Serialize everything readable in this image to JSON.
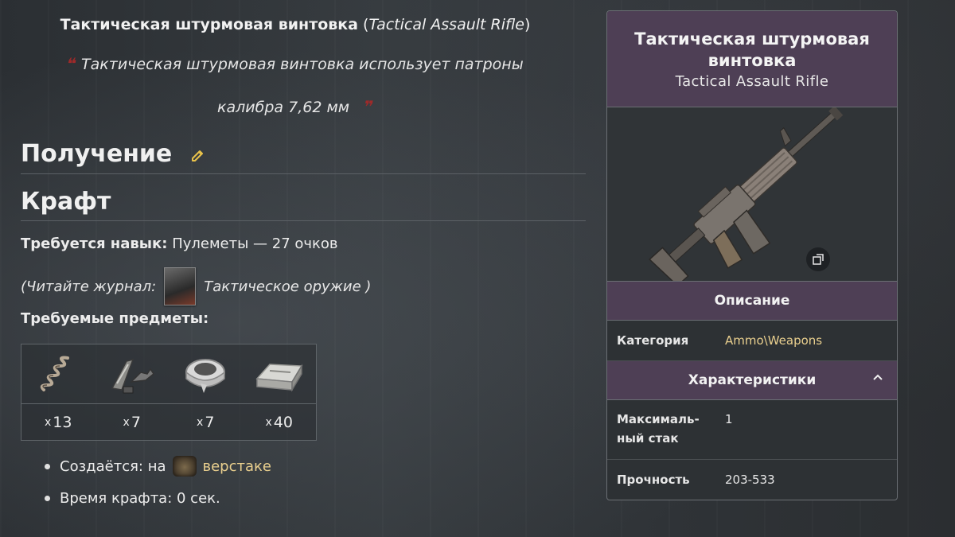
{
  "title": {
    "bold": "Тактическая штурмовая винтовка",
    "open": " (",
    "italic": "Tactical Assault Rifle",
    "close": ")"
  },
  "quote": {
    "line1": "Тактическая штурмовая винтовка использует патроны",
    "line2": "калибра 7,62 мм",
    "mark_open": "❝",
    "mark_close": "❞"
  },
  "sections": {
    "obtain": "Получение",
    "craft": "Крафт"
  },
  "skill": {
    "label": "Требуется навык:",
    "value": " Пулеметы — 27 очков"
  },
  "journal": {
    "prefix": "(Читайте журнал:",
    "name": "Тактическое оружие )"
  },
  "required_items": {
    "label": "Требуемые предметы:",
    "items": [
      {
        "icon": "spring-icon",
        "x": "x",
        "count": "13"
      },
      {
        "icon": "weapon-parts-icon",
        "x": "x",
        "count": "7"
      },
      {
        "icon": "duct-tape-icon",
        "x": "x",
        "count": "7"
      },
      {
        "icon": "iron-ingot-icon",
        "x": "x",
        "count": "40"
      }
    ]
  },
  "bullets": {
    "created_at": "Создаётся: на",
    "workbench": "верстаке",
    "craft_time": "Время крафта: 0 сек."
  },
  "infobox": {
    "title": "Тактическая штурмовая винтовка",
    "subtitle": "Tactical Assault Rifle",
    "description_header": "Описание",
    "category_key": "Категория",
    "category_value": "Ammo\\Weapons",
    "stats_header": "Характеристики",
    "max_stack_key": "Максималь-ный стак",
    "max_stack_value": "1",
    "durability_key": "Прочность",
    "durability_value": "203-533"
  },
  "colors": {
    "accent_purple": "#4e3f55",
    "link_gold": "#e9cf8e",
    "quote_red": "#9e2a2a"
  }
}
